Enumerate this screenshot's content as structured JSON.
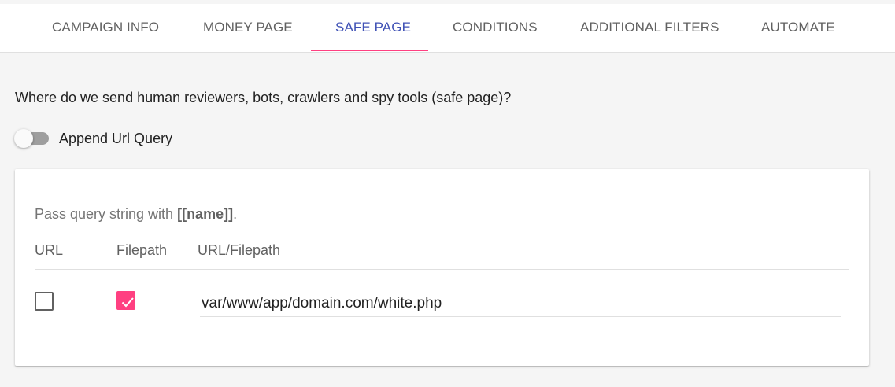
{
  "tabs": [
    {
      "label": "CAMPAIGN INFO",
      "active": false
    },
    {
      "label": "MONEY PAGE",
      "active": false
    },
    {
      "label": "SAFE PAGE",
      "active": true
    },
    {
      "label": "CONDITIONS",
      "active": false
    },
    {
      "label": "ADDITIONAL FILTERS",
      "active": false
    },
    {
      "label": "AUTOMATE",
      "active": false
    }
  ],
  "colors": {
    "active_tab": "#3f51b5",
    "indicator": "#ff4081",
    "checkbox_checked": "#ff4081"
  },
  "safe_page": {
    "question": "Where do we send human reviewers, bots, crawlers and spy tools (safe page)?",
    "append_toggle": {
      "label": "Append Url Query",
      "on": false
    },
    "hint_prefix": "Pass query string with ",
    "hint_token": "[[name]]",
    "hint_suffix": ".",
    "columns": {
      "url": "URL",
      "filepath": "Filepath",
      "url_filepath": "URL/Filepath"
    },
    "row": {
      "url_checked": false,
      "filepath_checked": true,
      "path_value": "var/www/app/domain.com/white.php"
    }
  }
}
